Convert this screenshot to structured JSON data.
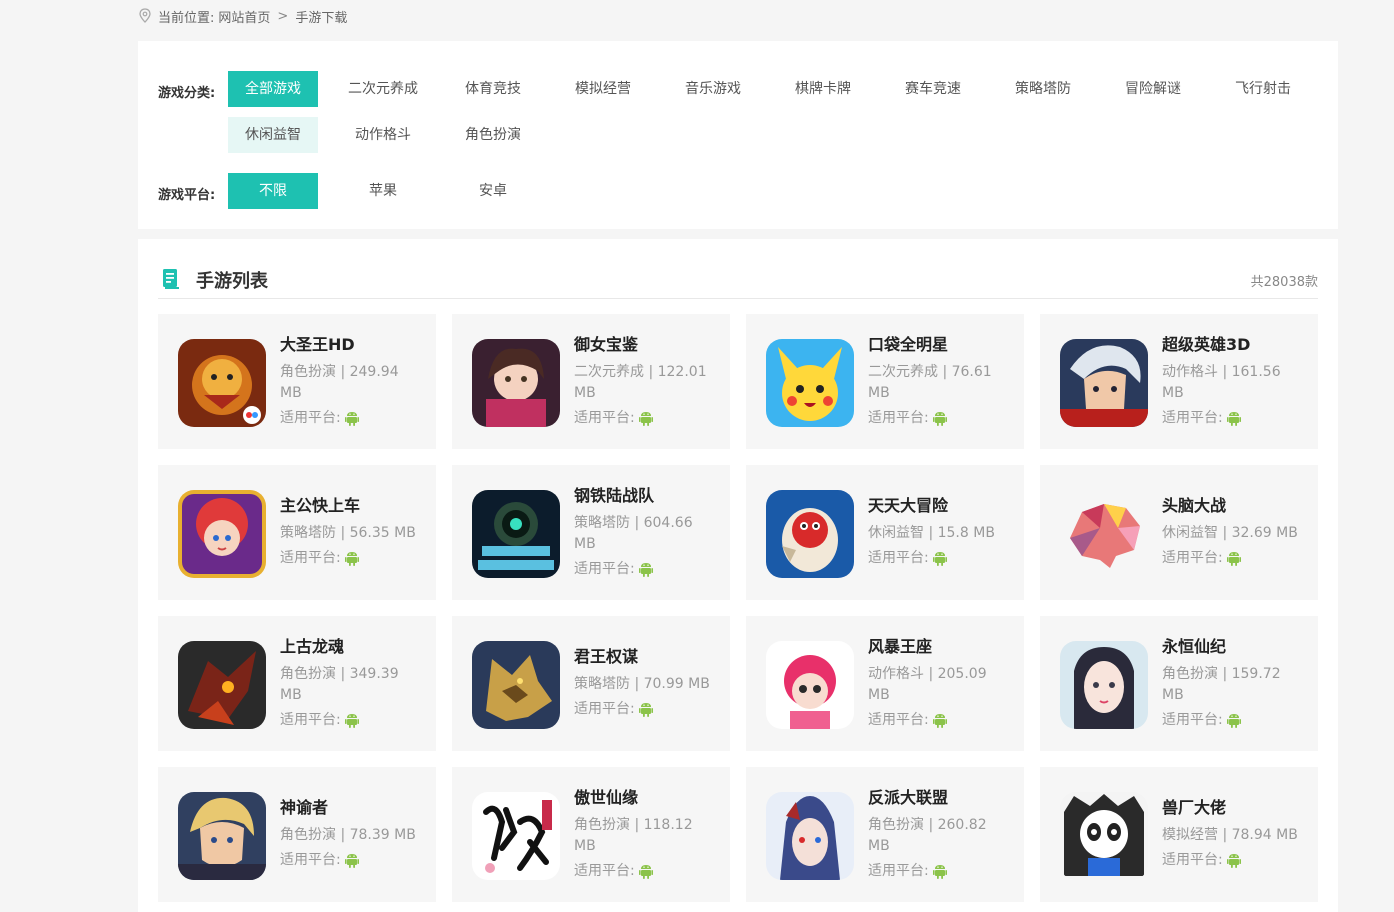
{
  "breadcrumb": {
    "prefix": "当前位置:",
    "home": "网站首页",
    "separator": ">",
    "current": "手游下载"
  },
  "filters": {
    "category_label": "游戏分类:",
    "categories": [
      "全部游戏",
      "二次元养成",
      "体育竞技",
      "模拟经营",
      "音乐游戏",
      "棋牌卡牌",
      "赛车竞速",
      "策略塔防",
      "冒险解谜",
      "飞行射击",
      "休闲益智",
      "动作格斗",
      "角色扮演"
    ],
    "selected_category": "全部游戏",
    "platform_label": "游戏平台:",
    "platforms": [
      "不限",
      "苹果",
      "安卓"
    ],
    "selected_platform": "不限"
  },
  "list": {
    "title": "手游列表",
    "count": "共28038款",
    "platform_label": "适用平台:",
    "games": [
      {
        "name": "大圣王HD",
        "meta": "角色扮演 | 249.94 MB",
        "icon": "monkey-king-icon"
      },
      {
        "name": "御女宝鉴",
        "meta": "二次元养成 | 122.01 MB",
        "icon": "anime-girl-icon"
      },
      {
        "name": "口袋全明星",
        "meta": "二次元养成 | 76.61 MB",
        "icon": "pikachu-icon"
      },
      {
        "name": "超级英雄3D",
        "meta": "动作格斗 | 161.56 MB",
        "icon": "hero-icon"
      },
      {
        "name": "主公快上车",
        "meta": "策略塔防 | 56.35 MB",
        "icon": "red-hair-hero-icon"
      },
      {
        "name": "钢铁陆战队",
        "meta": "策略塔防 | 604.66 MB",
        "icon": "iron-marines-icon"
      },
      {
        "name": "天天大冒险",
        "meta": "休闲益智 | 15.8 MB",
        "icon": "dragon-egg-icon"
      },
      {
        "name": "头脑大战",
        "meta": "休闲益智 | 32.69 MB",
        "icon": "brain-icon"
      },
      {
        "name": "上古龙魂",
        "meta": "角色扮演 | 349.39 MB",
        "icon": "dragon-icon"
      },
      {
        "name": "君王权谋",
        "meta": "策略塔防 | 70.99 MB",
        "icon": "wolf-icon"
      },
      {
        "name": "风暴王座",
        "meta": "动作格斗 | 205.09 MB",
        "icon": "pink-girl-icon"
      },
      {
        "name": "永恒仙纪",
        "meta": "角色扮演 | 159.72 MB",
        "icon": "fairy-icon"
      },
      {
        "name": "神谕者",
        "meta": "角色扮演 | 78.39 MB",
        "icon": "blond-warrior-icon"
      },
      {
        "name": "傲世仙缘",
        "meta": "角色扮演 | 118.12 MB",
        "icon": "calligraphy-icon"
      },
      {
        "name": "反派大联盟",
        "meta": "角色扮演 | 260.82 MB",
        "icon": "villain-icon"
      },
      {
        "name": "兽厂大佬",
        "meta": "模拟经营 | 78.94 MB",
        "icon": "panda-icon"
      }
    ]
  },
  "colors": {
    "accent": "#1ec1b1",
    "android_green": "#8bc34a",
    "card_bg": "#f6f6f6"
  }
}
